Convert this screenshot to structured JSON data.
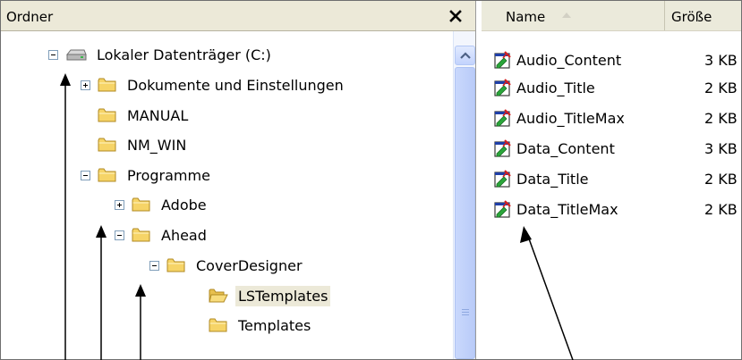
{
  "folders_pane": {
    "title": "Ordner",
    "tree": [
      {
        "label": "Lokaler Datenträger (C:)",
        "icon": "drive-icon",
        "expander": "minus"
      },
      {
        "label": "Dokumente und Einstellungen",
        "icon": "folder-icon",
        "expander": "plus"
      },
      {
        "label": "MANUAL",
        "icon": "folder-icon",
        "expander": "none"
      },
      {
        "label": "NM_WIN",
        "icon": "folder-icon",
        "expander": "none"
      },
      {
        "label": "Programme",
        "icon": "folder-icon",
        "expander": "minus"
      },
      {
        "label": "Adobe",
        "icon": "folder-icon",
        "expander": "plus"
      },
      {
        "label": "Ahead",
        "icon": "folder-icon",
        "expander": "minus"
      },
      {
        "label": "CoverDesigner",
        "icon": "folder-icon",
        "expander": "minus"
      },
      {
        "label": "LSTemplates",
        "icon": "open-folder-icon",
        "expander": "none",
        "selected": true
      },
      {
        "label": "Templates",
        "icon": "folder-icon",
        "expander": "none"
      }
    ]
  },
  "file_list": {
    "columns": {
      "name": "Name",
      "size": "Größe"
    },
    "sort_icon": "sort-ascending-icon",
    "files": [
      {
        "name": "Audio_Content",
        "size": "3 KB"
      },
      {
        "name": "Audio_Title",
        "size": "2 KB"
      },
      {
        "name": "Audio_TitleMax",
        "size": "2 KB"
      },
      {
        "name": "Data_Content",
        "size": "3 KB"
      },
      {
        "name": "Data_Title",
        "size": "2 KB"
      },
      {
        "name": "Data_TitleMax",
        "size": "2 KB"
      }
    ]
  },
  "colors": {
    "header_bg": "#ece9d8",
    "folder_yellow": "#f6d467",
    "scrollbar_blue": "#c3d3fd",
    "selection_bg": "#ece9d8"
  }
}
